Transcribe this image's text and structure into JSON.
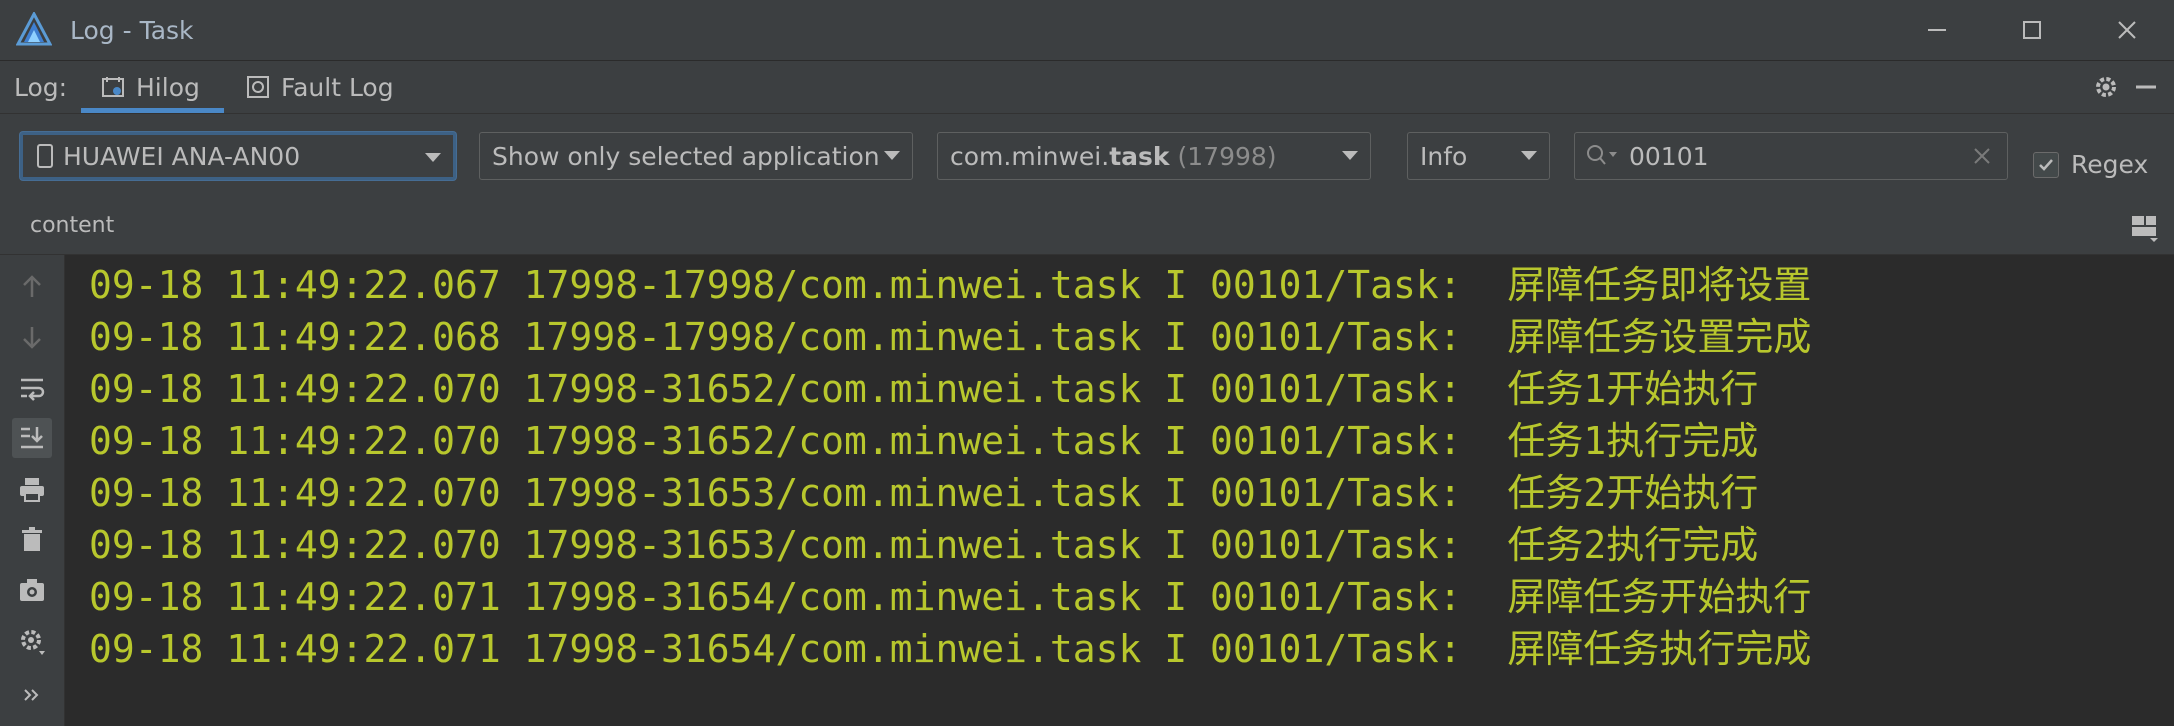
{
  "window": {
    "title": "Log - Task"
  },
  "tabs": {
    "label": "Log:",
    "items": [
      {
        "label": "Hilog",
        "icon": "hilog-icon",
        "active": true
      },
      {
        "label": "Fault Log",
        "icon": "fault-log-icon",
        "active": false
      }
    ]
  },
  "filters": {
    "device": "HUAWEI ANA-AN00",
    "app_filter": "Show only selected application",
    "process_prefix": "com.minwei.",
    "process_bold": "task",
    "process_pid": "(17998)",
    "level": "Info",
    "search_value": "00101",
    "regex_label": "Regex",
    "regex_checked": true
  },
  "header": {
    "label": "content"
  },
  "log_lines": [
    "09-18 11:49:22.067 17998-17998/com.minwei.task I 00101/Task:  屏障任务即将设置",
    "09-18 11:49:22.068 17998-17998/com.minwei.task I 00101/Task:  屏障任务设置完成",
    "09-18 11:49:22.070 17998-31652/com.minwei.task I 00101/Task:  任务1开始执行",
    "09-18 11:49:22.070 17998-31652/com.minwei.task I 00101/Task:  任务1执行完成",
    "09-18 11:49:22.070 17998-31653/com.minwei.task I 00101/Task:  任务2开始执行",
    "09-18 11:49:22.070 17998-31653/com.minwei.task I 00101/Task:  任务2执行完成",
    "09-18 11:49:22.071 17998-31654/com.minwei.task I 00101/Task:  屏障任务开始执行",
    "09-18 11:49:22.071 17998-31654/com.minwei.task I 00101/Task:  屏障任务执行完成"
  ],
  "colors": {
    "log_text": "#b8c72d",
    "accent": "#4a88c7",
    "background": "#2b2b2b",
    "panel": "#3c3f41"
  }
}
